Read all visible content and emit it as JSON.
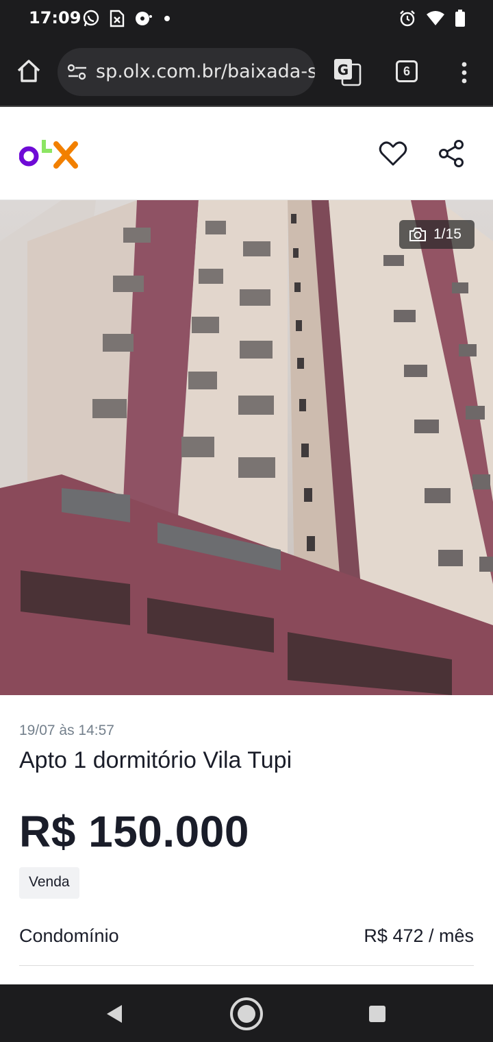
{
  "status_bar": {
    "time": "17:09",
    "left_icons": [
      "whatsapp-icon",
      "document-icon",
      "podcast-icon",
      "dot-icon"
    ],
    "right_icons": [
      "alarm-icon",
      "wifi-icon",
      "battery-icon"
    ]
  },
  "browser": {
    "url": "sp.olx.com.br/baixada-santista",
    "tab_count": "6"
  },
  "site": {
    "brand": "OLX",
    "brand_colors": {
      "o": "#6e0ad6",
      "l": "#8ce563",
      "x": "#f28000"
    }
  },
  "gallery": {
    "counter": "1/15",
    "image_alt": "Building photo"
  },
  "ad": {
    "date": "19/07 às 14:57",
    "title": "Apto 1 dormitório Vila Tupi",
    "price": "R$ 150.000",
    "badge": "Venda",
    "condo_label": "Condomínio",
    "condo_value": "R$ 472 / mês"
  }
}
